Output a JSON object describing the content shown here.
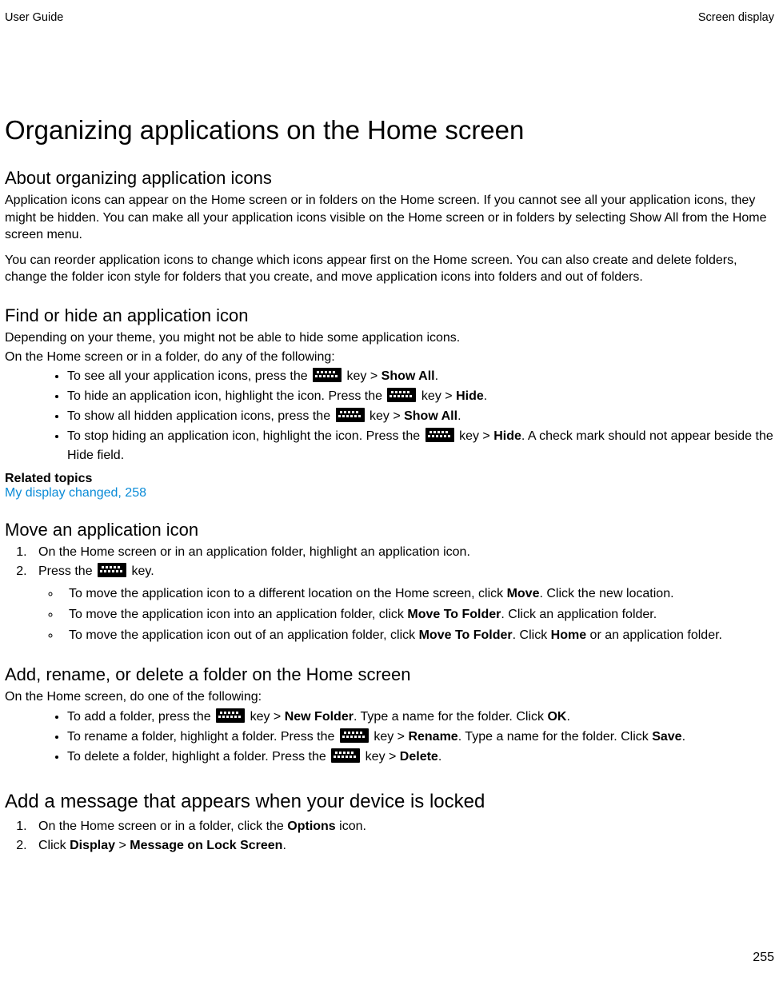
{
  "header": {
    "left": "User Guide",
    "right": "Screen display"
  },
  "h1": "Organizing applications on the Home screen",
  "sec1": {
    "title": "About organizing application icons",
    "p1": "Application icons can appear on the Home screen or in folders on the Home screen. If you cannot see all your application icons, they might be hidden. You can make all your application icons visible on the Home screen or in folders by selecting Show All from the Home screen menu.",
    "p2": "You can reorder application icons to change which icons appear first on the Home screen. You can also create and delete folders, change the folder icon style for folders that you create, and move application icons into folders and out of folders."
  },
  "sec2": {
    "title": "Find or hide an application icon",
    "p1": "Depending on your theme, you might not be able to hide some application icons.",
    "p2": "On the Home screen or in a folder, do any of the following:",
    "b1a": "To see all your application icons, press the ",
    "b1b": " key > ",
    "b1c": "Show All",
    "b1d": ".",
    "b2a": "To hide an application icon, highlight the icon. Press the ",
    "b2b": " key > ",
    "b2c": "Hide",
    "b2d": ".",
    "b3a": "To show all hidden application icons, press the ",
    "b3b": " key > ",
    "b3c": "Show All",
    "b3d": ".",
    "b4a": "To stop hiding an application icon, highlight the icon. Press the ",
    "b4b": " key > ",
    "b4c": "Hide",
    "b4d": ". A check mark should not appear beside the Hide field.",
    "related_label": "Related topics",
    "related_link": "My display changed, 258"
  },
  "sec3": {
    "title": "Move an application icon",
    "o1": "On the Home screen or in an application folder, highlight an application icon.",
    "o2a": "Press the ",
    "o2b": " key.",
    "s1a": "To move the application icon to a different location on the Home screen, click ",
    "s1b": "Move",
    "s1c": ". Click the new location.",
    "s2a": "To move the application icon into an application folder, click ",
    "s2b": "Move To Folder",
    "s2c": ". Click an application folder.",
    "s3a": "To move the application icon out of an application folder, click ",
    "s3b": "Move To Folder",
    "s3c": ". Click ",
    "s3d": "Home",
    "s3e": " or an application folder."
  },
  "sec4": {
    "title": "Add, rename, or delete a folder on the Home screen",
    "p1": "On the Home screen, do one of the following:",
    "b1a": "To add a folder, press the ",
    "b1b": " key > ",
    "b1c": "New Folder",
    "b1d": ". Type a name for the folder. Click ",
    "b1e": "OK",
    "b1f": ".",
    "b2a": "To rename a folder, highlight a folder. Press the ",
    "b2b": " key > ",
    "b2c": "Rename",
    "b2d": ". Type a name for the folder. Click ",
    "b2e": "Save",
    "b2f": ".",
    "b3a": "To delete a folder, highlight a folder. Press the ",
    "b3b": " key > ",
    "b3c": "Delete",
    "b3d": "."
  },
  "sec5": {
    "title": "Add a message that appears when your device is locked",
    "o1a": "On the Home screen or in a folder, click the ",
    "o1b": "Options",
    "o1c": " icon.",
    "o2a": "Click ",
    "o2b": "Display",
    "o2c": " > ",
    "o2d": "Message on Lock Screen",
    "o2e": "."
  },
  "footer": "255"
}
